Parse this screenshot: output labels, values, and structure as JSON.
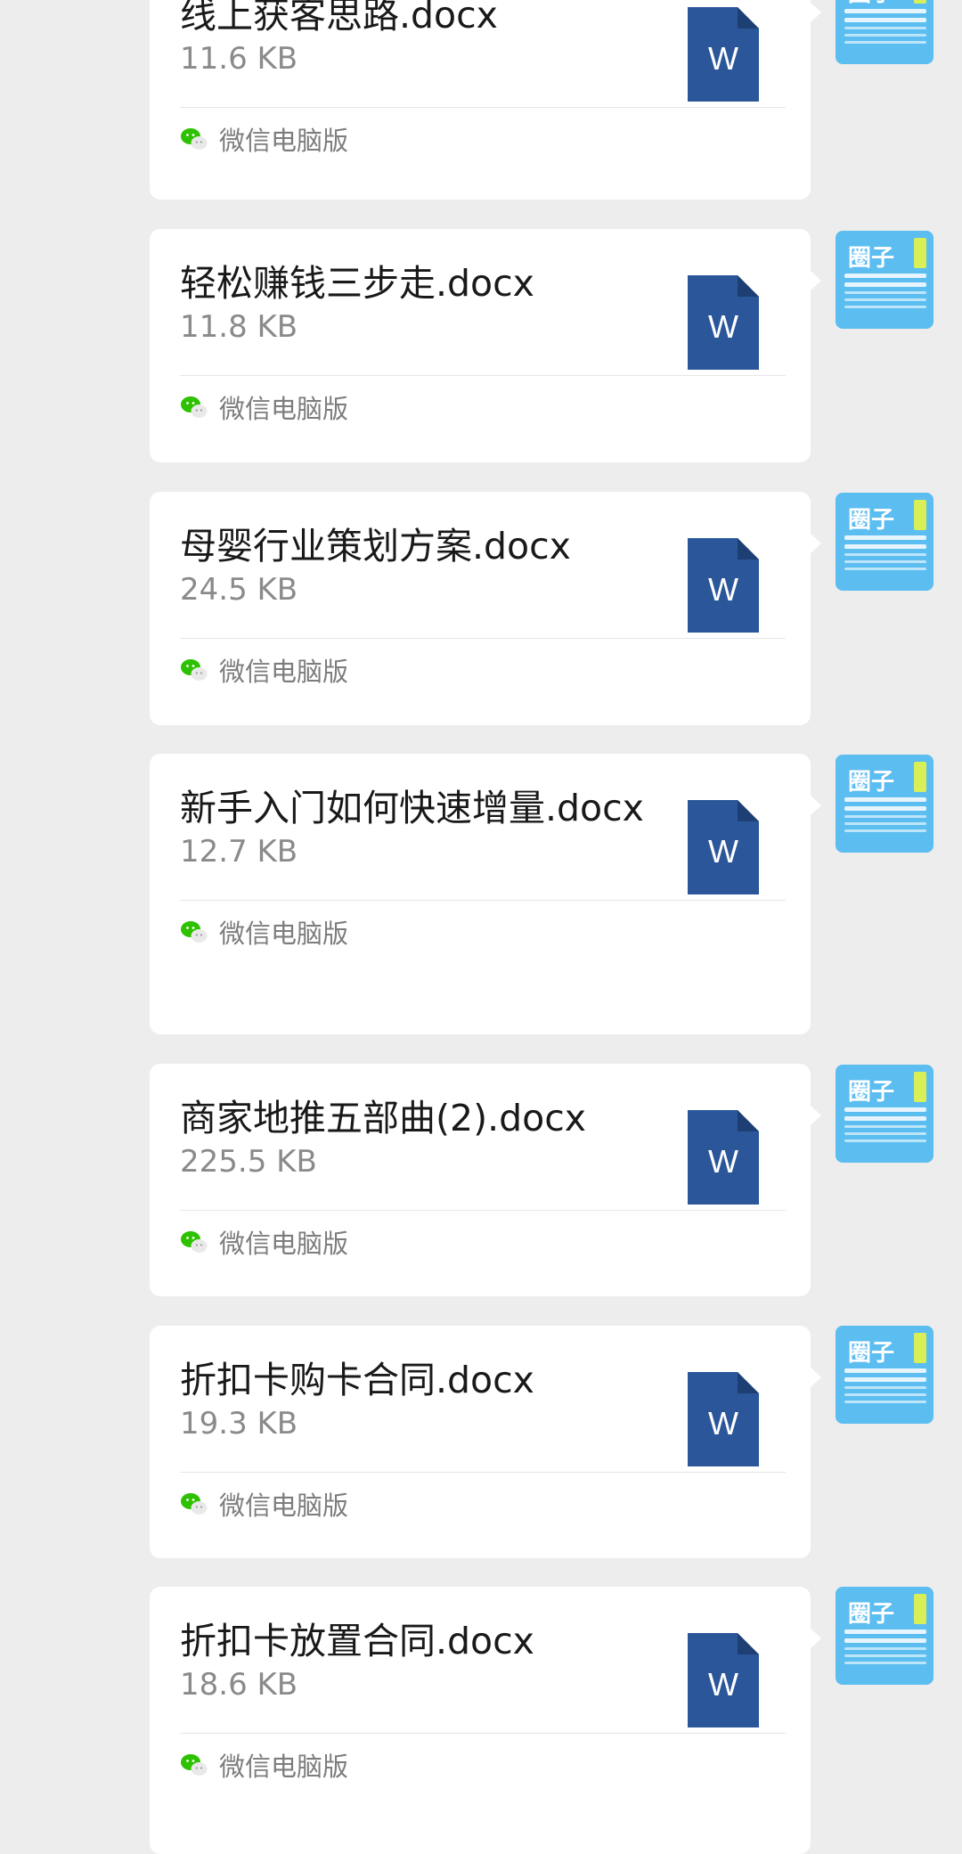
{
  "messages": [
    {
      "file_name": "线上获客思路.docx",
      "file_size": "11.6 KB",
      "source": "微信电脑版",
      "file_icon": "word-doc-icon",
      "file_icon_letter": "W"
    },
    {
      "file_name": "轻松赚钱三步走.docx",
      "file_size": "11.8 KB",
      "source": "微信电脑版",
      "file_icon": "word-doc-icon",
      "file_icon_letter": "W"
    },
    {
      "file_name": "母婴行业策划方案.docx",
      "file_size": "24.5 KB",
      "source": "微信电脑版",
      "file_icon": "word-doc-icon",
      "file_icon_letter": "W"
    },
    {
      "file_name": "新手入门如何快速增量.docx",
      "file_size": "12.7 KB",
      "source": "微信电脑版",
      "file_icon": "word-doc-icon",
      "file_icon_letter": "W"
    },
    {
      "file_name": "商家地推五部曲(2).docx",
      "file_size": "225.5 KB",
      "source": "微信电脑版",
      "file_icon": "word-doc-icon",
      "file_icon_letter": "W"
    },
    {
      "file_name": "折扣卡购卡合同.docx",
      "file_size": "19.3 KB",
      "source": "微信电脑版",
      "file_icon": "word-doc-icon",
      "file_icon_letter": "W"
    },
    {
      "file_name": "折扣卡放置合同.docx",
      "file_size": "18.6 KB",
      "source": "微信电脑版",
      "file_icon": "word-doc-icon",
      "file_icon_letter": "W"
    }
  ],
  "avatar": {
    "text": "圈子",
    "icon": "user-avatar"
  },
  "colors": {
    "background": "#ededed",
    "card": "#ffffff",
    "word_blue": "#2b579a",
    "wechat_green": "#07c160",
    "avatar_blue": "#5bbdf0"
  }
}
